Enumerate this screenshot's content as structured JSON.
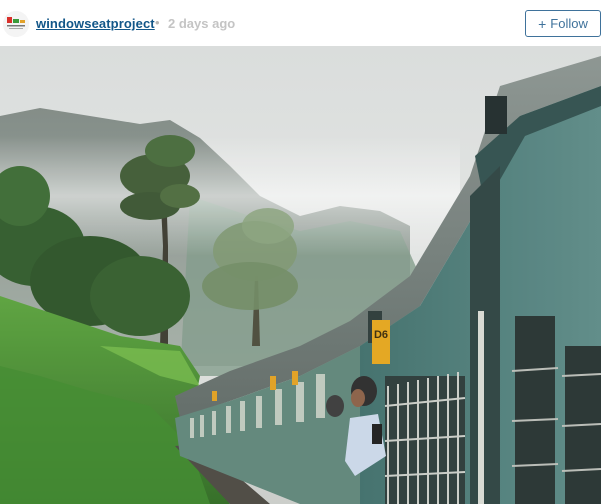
{
  "post": {
    "username": "windowseatproject",
    "separator": "•",
    "timestamp": "2 days ago",
    "follow_label": "Follow",
    "follow_icon": "plus-icon"
  },
  "photo": {
    "subject": "train-through-misty-hills",
    "coach_sign": "D6"
  },
  "colors": {
    "username": "#125688",
    "timestamp": "#c4c4c4",
    "follow_accent": "#3f729b"
  }
}
